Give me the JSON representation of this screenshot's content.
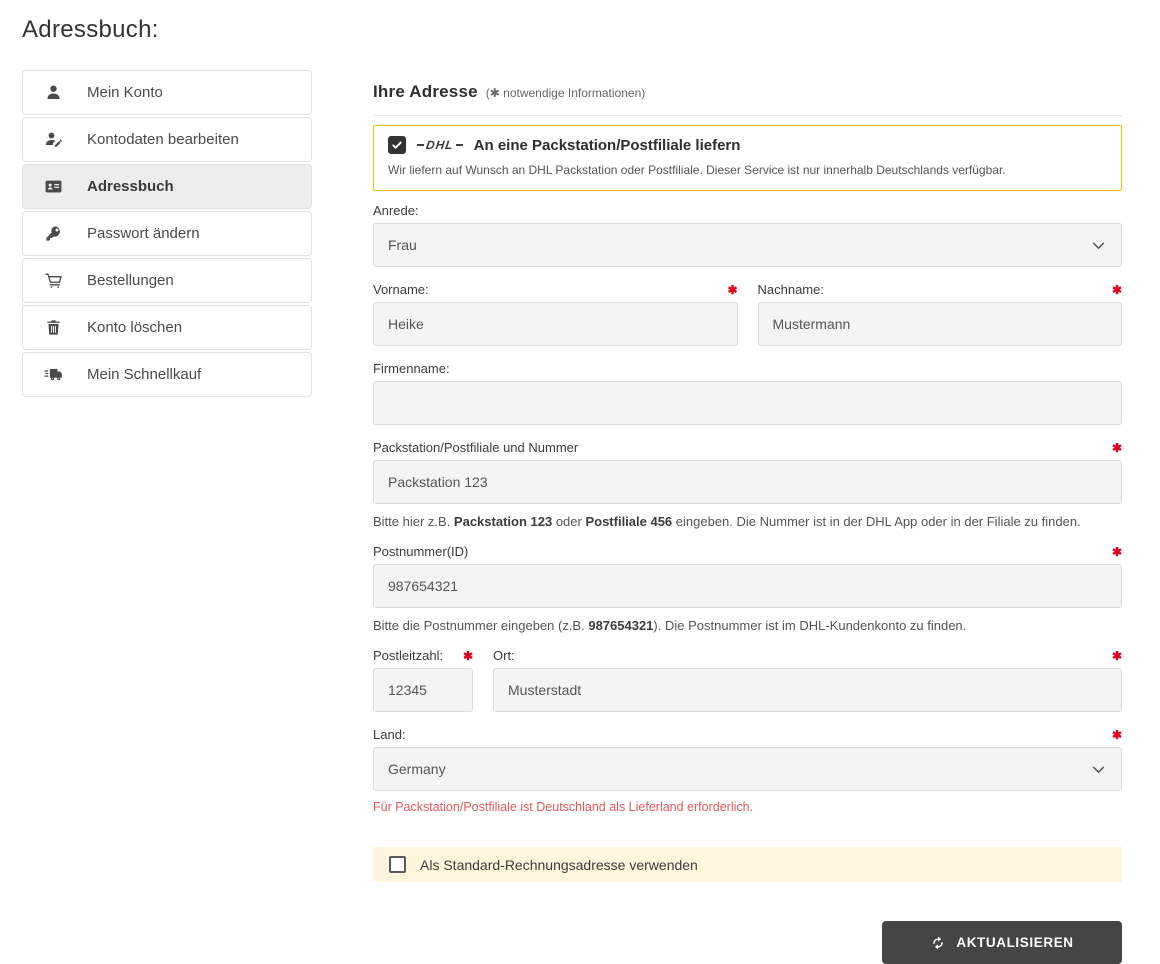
{
  "page": {
    "title": "Adressbuch:"
  },
  "sidebar": {
    "items": [
      {
        "label": "Mein Konto",
        "icon": "user-icon",
        "active": false
      },
      {
        "label": "Kontodaten bearbeiten",
        "icon": "user-edit-icon",
        "active": false
      },
      {
        "label": "Adressbuch",
        "icon": "address-card-icon",
        "active": true
      },
      {
        "label": "Passwort ändern",
        "icon": "key-icon",
        "active": false
      },
      {
        "label": "Bestellungen",
        "icon": "cart-icon",
        "active": false
      },
      {
        "label": "Konto löschen",
        "icon": "trash-icon",
        "active": false
      },
      {
        "label": "Mein Schnellkauf",
        "icon": "truck-icon",
        "active": false
      }
    ]
  },
  "form": {
    "heading": "Ihre Adresse",
    "heading_note": "(✱ notwendige Informationen)",
    "required_marker": "✱",
    "dhl": {
      "logo": "DHL",
      "label": "An eine Packstation/Postfiliale liefern",
      "checked": true,
      "description": "Wir liefern auf Wunsch an DHL Packstation oder Postfiliale. Dieser Service ist nur innerhalb Deutschlands verfügbar."
    },
    "fields": {
      "anrede": {
        "label": "Anrede:",
        "value": "Frau",
        "required": false
      },
      "vorname": {
        "label": "Vorname:",
        "value": "Heike",
        "required": true
      },
      "nachname": {
        "label": "Nachname:",
        "value": "Mustermann",
        "required": true
      },
      "firmenname": {
        "label": "Firmenname:",
        "value": "",
        "required": false
      },
      "packstation": {
        "label": "Packstation/Postfiliale und Nummer",
        "value": "Packstation 123",
        "required": true,
        "hint": {
          "part1": "Bitte hier z.B. ",
          "bold1": "Packstation 123",
          "part2": " oder ",
          "bold2": "Postfiliale 456",
          "part3": " eingeben. Die Nummer ist in der DHL App oder in der Filiale zu finden."
        }
      },
      "postnummer": {
        "label": "Postnummer(ID)",
        "value": "987654321",
        "required": true,
        "hint": {
          "part1": "Bitte die Postnummer eingeben (z.B. ",
          "bold1": "987654321",
          "part2": "). Die Postnummer ist im DHL-Kundenkonto zu finden."
        }
      },
      "postleitzahl": {
        "label": "Postleitzahl:",
        "value": "12345",
        "required": true
      },
      "ort": {
        "label": "Ort:",
        "value": "Musterstadt",
        "required": true
      },
      "land": {
        "label": "Land:",
        "value": "Germany",
        "required": true,
        "error": "Für Packstation/Postfiliale ist Deutschland als Lieferland erforderlich."
      }
    },
    "standard_billing": {
      "label": "Als Standard-Rechnungsadresse verwenden",
      "checked": false
    },
    "submit": {
      "label": "AKTUALISIEREN",
      "icon": "sync-icon"
    }
  },
  "colors": {
    "dhl_box_border": "#f2c400",
    "required_red": "#e2001a",
    "error_red": "#e25b5b",
    "button_bg": "#454545",
    "billing_bar_bg": "#fdf5dc",
    "input_bg": "#f4f4f4",
    "active_item_bg": "#ededed"
  }
}
